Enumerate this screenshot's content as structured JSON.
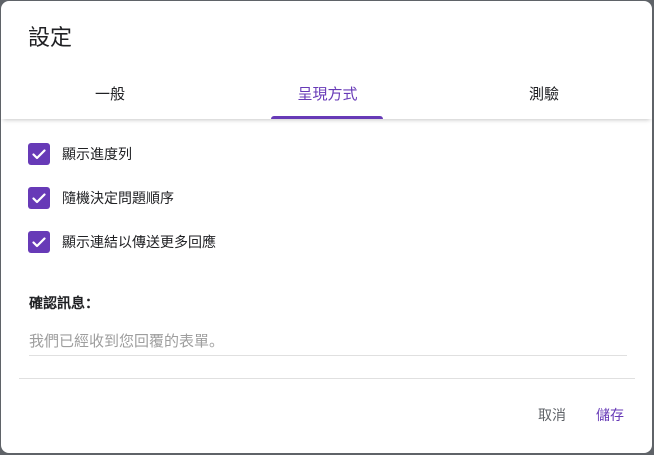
{
  "dialog": {
    "title": "設定"
  },
  "tabs": [
    {
      "label": "一般",
      "active": false
    },
    {
      "label": "呈現方式",
      "active": true
    },
    {
      "label": "測驗",
      "active": false
    }
  ],
  "options": [
    {
      "label": "顯示進度列",
      "checked": true
    },
    {
      "label": "隨機決定問題順序",
      "checked": true
    },
    {
      "label": "顯示連結以傳送更多回應",
      "checked": true
    }
  ],
  "confirmation": {
    "label": "確認訊息：",
    "value": "",
    "placeholder": "我們已經收到您回覆的表單。"
  },
  "actions": {
    "cancel_label": "取消",
    "save_label": "儲存"
  },
  "colors": {
    "accent": "#673ab7",
    "text": "#202124",
    "muted": "#5f6368",
    "placeholder": "#9e9e9e",
    "divider": "#e0e0e0"
  }
}
